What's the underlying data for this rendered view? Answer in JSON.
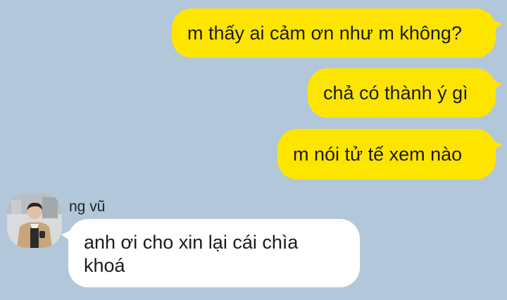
{
  "conversation": {
    "messages": [
      {
        "direction": "outgoing",
        "text": "m thấy ai cảm ơn như m không?"
      },
      {
        "direction": "outgoing",
        "text": "chả có thành ý gì"
      },
      {
        "direction": "outgoing",
        "text": "m nói tử tế xem nào"
      },
      {
        "direction": "incoming",
        "sender": "ng vũ",
        "text": "anh ơi cho xin lại cái chìa khoá"
      }
    ]
  },
  "colors": {
    "background": "#b2c7d9",
    "outgoing_bubble": "#fee500",
    "incoming_bubble": "#ffffff"
  },
  "icons": {
    "sender_avatar": "profile-photo-icon"
  }
}
